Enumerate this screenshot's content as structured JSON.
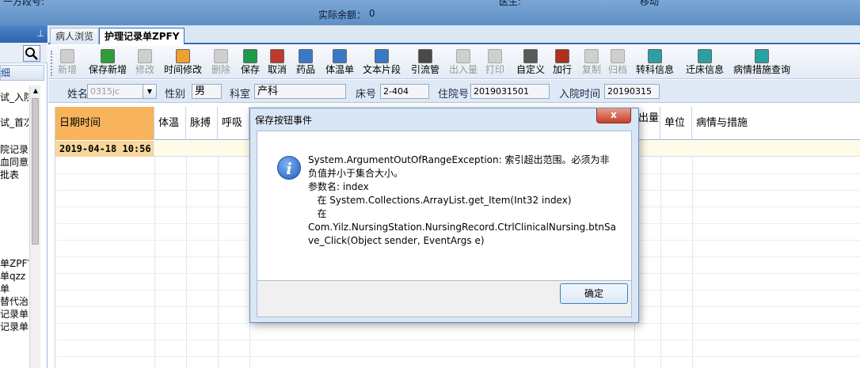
{
  "topbar": {
    "frag1": "一方段号:",
    "frag2": "实际余额：",
    "frag3": "0",
    "frag4": "医生:",
    "frag5": "移动"
  },
  "left_panel": {
    "tab_label": "细",
    "tree_items": [
      "试_入院",
      "试_首次",
      "院记录",
      "血同意",
      "批表",
      "单ZPFY",
      "单qzz",
      "单",
      "替代治",
      "记录单",
      "记录单"
    ]
  },
  "tabs": [
    {
      "label": "病人浏览"
    },
    {
      "label": "护理记录单ZPFY"
    }
  ],
  "toolbar": {
    "buttons": [
      {
        "label": "新增",
        "icon": "add-icon",
        "enabled": false
      },
      {
        "label": "保存新增",
        "icon": "save-add-icon",
        "enabled": true
      },
      {
        "label": "修改",
        "icon": "edit-icon",
        "enabled": false
      },
      {
        "label": "时间修改",
        "icon": "time-edit-icon",
        "enabled": true
      },
      {
        "label": "删除",
        "icon": "delete-icon",
        "enabled": false
      },
      {
        "label": "保存",
        "icon": "save-icon",
        "enabled": true
      },
      {
        "label": "取消",
        "icon": "undo-icon",
        "enabled": true
      },
      {
        "label": "药品",
        "icon": "medicine-icon",
        "enabled": true
      },
      {
        "label": "体温单",
        "icon": "temperature-chart-icon",
        "enabled": true
      },
      {
        "label": "文本片段",
        "icon": "text-snippet-icon",
        "enabled": true
      },
      {
        "label": "引流管",
        "icon": "drainage-tube-icon",
        "enabled": true
      },
      {
        "label": "出入量",
        "icon": "intake-output-icon",
        "enabled": false
      },
      {
        "label": "打印",
        "icon": "print-icon",
        "enabled": false
      },
      {
        "label": "自定义",
        "icon": "custom-icon",
        "enabled": true
      },
      {
        "label": "加行",
        "icon": "add-row-icon",
        "enabled": true
      },
      {
        "label": "复制",
        "icon": "copy-icon",
        "enabled": false
      },
      {
        "label": "归档",
        "icon": "archive-icon",
        "enabled": false
      },
      {
        "label": "转科信息",
        "icon": "transfer-info-icon",
        "enabled": true
      },
      {
        "label": "迁床信息",
        "icon": "bed-move-icon",
        "enabled": true
      },
      {
        "label": "病情措施查询",
        "icon": "condition-query-icon",
        "enabled": true
      }
    ]
  },
  "patient": {
    "name_label": "姓名",
    "name_value": "0315jc",
    "gender_label": "性别",
    "gender_value": "男",
    "dept_label": "科室",
    "dept_value": "产科",
    "bed_label": "床号",
    "bed_value": "2-404",
    "admission_no_label": "住院号",
    "admission_no_value": "2019031501",
    "admission_time_label": "入院时间",
    "admission_time_value": "20190315"
  },
  "grid": {
    "headers": [
      "日期时间",
      "体温",
      "脉搏",
      "呼吸",
      "",
      "",
      "",
      "",
      "",
      "",
      "",
      "单位",
      "病情与措施"
    ],
    "partial_header": "出量",
    "rows": [
      {
        "datetime": "2019-04-18 10:56"
      }
    ]
  },
  "dialog": {
    "title": "保存按钮事件",
    "close_label": "x",
    "message": "System.ArgumentOutOfRangeException: 索引超出范围。必须为非\n负值并小于集合大小。\n参数名: index\n   在 System.Collections.ArrayList.get_Item(Int32 index)\n   在\nCom.Yilz.NursingStation.NursingRecord.CtrlClinicalNursing.btnSa\nve_Click(Object sender, EventArgs e)",
    "ok_label": "确定"
  },
  "colors": {
    "accent_blue": "#2d6bbd",
    "header_orange": "#f7b45c",
    "row_highlight": "#f8d89a",
    "dialog_frame": "#d9e6f5",
    "close_red": "#c6402b"
  }
}
